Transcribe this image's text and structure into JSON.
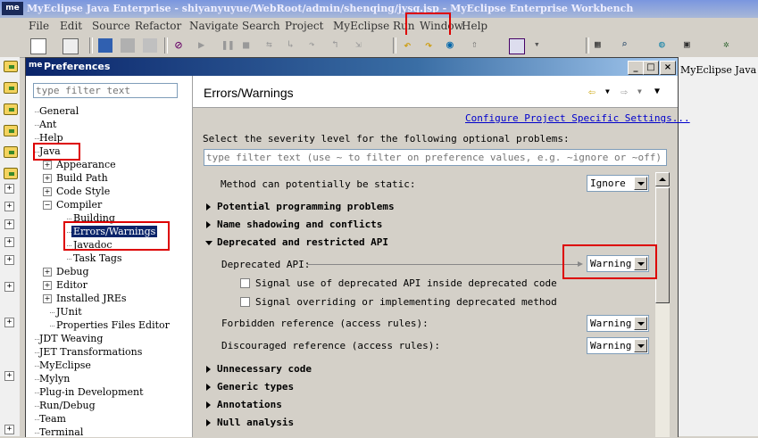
{
  "window": {
    "title": "MyEclipse Java Enterprise - shiyanyuyue/WebRoot/admin/shenqing/jysq.jsp - MyEclipse Enterprise Workbench",
    "logo": "me"
  },
  "menu": [
    "File",
    "Edit",
    "Source",
    "Refactor",
    "Navigate",
    "Search",
    "Project",
    "MyEclipse",
    "Run",
    "Window",
    "Help"
  ],
  "editor_tab": "MyEclipse Java",
  "dialog": {
    "title": "Preferences",
    "logo": "me",
    "buttons": {
      "minimize": "_",
      "maximize": "□",
      "close": "×"
    },
    "filter_placeholder": "type filter text",
    "tree": [
      {
        "label": "General"
      },
      {
        "label": "Ant"
      },
      {
        "label": "Help"
      },
      {
        "label": "Java"
      },
      {
        "label": "Appearance"
      },
      {
        "label": "Build Path"
      },
      {
        "label": "Code Style"
      },
      {
        "label": "Compiler"
      },
      {
        "label": "Building"
      },
      {
        "label": "Errors/Warnings"
      },
      {
        "label": "Javadoc"
      },
      {
        "label": "Task Tags"
      },
      {
        "label": "Debug"
      },
      {
        "label": "Editor"
      },
      {
        "label": "Installed JREs"
      },
      {
        "label": "JUnit"
      },
      {
        "label": "Properties Files Editor"
      },
      {
        "label": "JDT Weaving"
      },
      {
        "label": "JET Transformations"
      },
      {
        "label": "MyEclipse"
      },
      {
        "label": "Mylyn"
      },
      {
        "label": "Plug-in Development"
      },
      {
        "label": "Run/Debug"
      },
      {
        "label": "Team"
      },
      {
        "label": "Terminal"
      }
    ],
    "page": {
      "title": "Errors/Warnings",
      "configure_link": "Configure Project Specific Settings...",
      "description": "Select the severity level for the following optional problems:",
      "search_placeholder": "type filter text (use ~ to filter on preference values, e.g. ~ignore or ~off)",
      "static_method": {
        "label": "Method can potentially be static:",
        "value": "Ignore"
      },
      "sections": {
        "potential": "Potential programming problems",
        "shadowing": "Name shadowing and conflicts",
        "deprecated": "Deprecated and restricted API",
        "unnecessary": "Unnecessary code",
        "generic": "Generic types",
        "annotations": "Annotations",
        "null": "Null analysis"
      },
      "deprecated_api": {
        "label": "Deprecated API:",
        "value": "Warning"
      },
      "signal_inside": {
        "label": "Signal use of deprecated API inside deprecated code",
        "checked": false
      },
      "signal_overriding": {
        "label": "Signal overriding or implementing deprecated method",
        "checked": false
      },
      "forbidden": {
        "label": "Forbidden reference (access rules):",
        "value": "Warning"
      },
      "discouraged": {
        "label": "Discouraged reference (access rules):",
        "value": "Warning"
      }
    }
  },
  "colors": {
    "highlight_box": "#dd0000",
    "selection": "#0a246a",
    "link": "#0000cc"
  }
}
